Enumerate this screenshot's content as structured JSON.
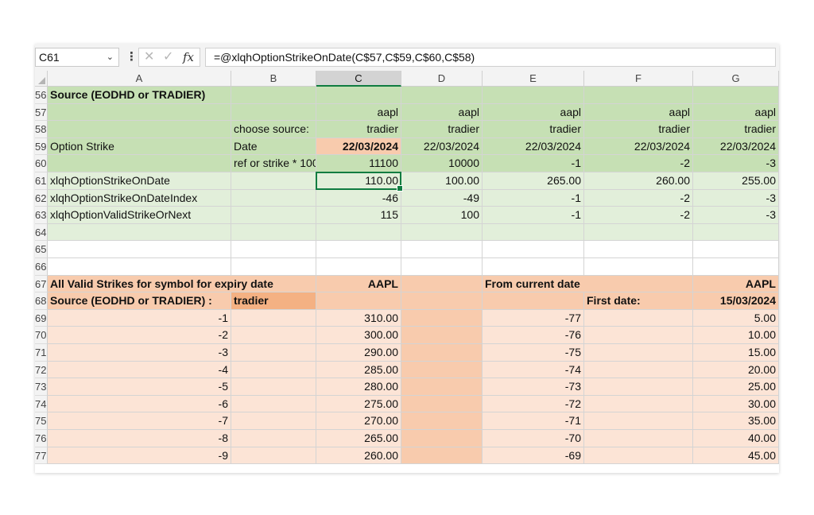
{
  "name_box": "C61",
  "formula": "=@xlqhOptionStrikeOnDate(C$57,C$59,C$60,C$58)",
  "icons": {
    "cancel": "x-icon",
    "confirm": "check-icon",
    "function": "fx-icon",
    "dropdown": "chevron-down-icon",
    "more": "vertical-dots-icon"
  },
  "colors": {
    "green_dark": "#c6e0b4",
    "green_light": "#e2efda",
    "peach_dark": "#f8cbad",
    "peach_light": "#fce4d6",
    "accent_orange": "#f4b183",
    "selection": "#107c41"
  },
  "columns": [
    "A",
    "B",
    "C",
    "D",
    "E",
    "F",
    "G"
  ],
  "selected_column": "C",
  "rows": [
    {
      "n": "56",
      "bg": "#c6e0b4",
      "cells": [
        {
          "c": "A",
          "v": "Source (EODHD or TRADIER)",
          "b": true
        }
      ]
    },
    {
      "n": "57",
      "bg": "#c6e0b4",
      "cells": [
        {
          "c": "C",
          "v": "aapl",
          "r": true
        },
        {
          "c": "D",
          "v": "aapl",
          "r": true
        },
        {
          "c": "E",
          "v": "aapl",
          "r": true
        },
        {
          "c": "F",
          "v": "aapl",
          "r": true
        },
        {
          "c": "G",
          "v": "aapl",
          "r": true
        }
      ]
    },
    {
      "n": "58",
      "bg": "#c6e0b4",
      "cells": [
        {
          "c": "B",
          "v": "choose source:"
        },
        {
          "c": "C",
          "v": "tradier",
          "r": true
        },
        {
          "c": "D",
          "v": "tradier",
          "r": true
        },
        {
          "c": "E",
          "v": "tradier",
          "r": true
        },
        {
          "c": "F",
          "v": "tradier",
          "r": true
        },
        {
          "c": "G",
          "v": "tradier",
          "r": true
        }
      ]
    },
    {
      "n": "59",
      "bg": "#c6e0b4",
      "cells": [
        {
          "c": "A",
          "v": "Option Strike"
        },
        {
          "c": "B",
          "v": "Date"
        },
        {
          "c": "C",
          "v": "22/03/2024",
          "r": true,
          "b": true,
          "bg": "#f8cbad"
        },
        {
          "c": "D",
          "v": "22/03/2024",
          "r": true
        },
        {
          "c": "E",
          "v": "22/03/2024",
          "r": true
        },
        {
          "c": "F",
          "v": "22/03/2024",
          "r": true
        },
        {
          "c": "G",
          "v": "22/03/2024",
          "r": true
        }
      ]
    },
    {
      "n": "60",
      "bg": "#c6e0b4",
      "cells": [
        {
          "c": "B",
          "v": "ref or strike * 1000"
        },
        {
          "c": "C",
          "v": "11100",
          "r": true
        },
        {
          "c": "D",
          "v": "10000",
          "r": true
        },
        {
          "c": "E",
          "v": "-1",
          "r": true
        },
        {
          "c": "F",
          "v": "-2",
          "r": true
        },
        {
          "c": "G",
          "v": "-3",
          "r": true
        }
      ]
    },
    {
      "n": "61",
      "bg": "#e2efda",
      "cells": [
        {
          "c": "A",
          "v": "xlqhOptionStrikeOnDate"
        },
        {
          "c": "C",
          "v": "110.00",
          "r": true
        },
        {
          "c": "D",
          "v": "100.00",
          "r": true
        },
        {
          "c": "E",
          "v": "265.00",
          "r": true
        },
        {
          "c": "F",
          "v": "260.00",
          "r": true
        },
        {
          "c": "G",
          "v": "255.00",
          "r": true
        }
      ]
    },
    {
      "n": "62",
      "bg": "#e2efda",
      "cells": [
        {
          "c": "A",
          "v": "xlqhOptionStrikeOnDateIndex"
        },
        {
          "c": "C",
          "v": "-46",
          "r": true
        },
        {
          "c": "D",
          "v": "-49",
          "r": true
        },
        {
          "c": "E",
          "v": "-1",
          "r": true
        },
        {
          "c": "F",
          "v": "-2",
          "r": true
        },
        {
          "c": "G",
          "v": "-3",
          "r": true
        }
      ]
    },
    {
      "n": "63",
      "bg": "#e2efda",
      "cells": [
        {
          "c": "A",
          "v": " xlqhOptionValidStrikeOrNext"
        },
        {
          "c": "C",
          "v": "115",
          "r": true
        },
        {
          "c": "D",
          "v": "100",
          "r": true
        },
        {
          "c": "E",
          "v": "-1",
          "r": true
        },
        {
          "c": "F",
          "v": "-2",
          "r": true
        },
        {
          "c": "G",
          "v": "-3",
          "r": true
        }
      ]
    },
    {
      "n": "64",
      "bg": "#e2efda",
      "cells": []
    },
    {
      "n": "65",
      "bg": "#ffffff",
      "cells": []
    },
    {
      "n": "66",
      "bg": "#ffffff",
      "cells": []
    },
    {
      "n": "67",
      "bg": "#f8cbad",
      "cells": [
        {
          "c": "A",
          "v": "All Valid Strikes for symbol for expiry date",
          "b": true
        },
        {
          "c": "C",
          "v": "AAPL",
          "r": true,
          "b": true
        },
        {
          "c": "E",
          "v": "From current date",
          "b": true
        },
        {
          "c": "G",
          "v": "AAPL",
          "r": true,
          "b": true
        }
      ]
    },
    {
      "n": "68",
      "bg": "#f8cbad",
      "cells": [
        {
          "c": "A",
          "v": "Source (EODHD or TRADIER) :",
          "b": true
        },
        {
          "c": "B",
          "v": "tradier",
          "b": true,
          "bg": "#f4b183"
        },
        {
          "c": "F",
          "v": "First date:",
          "b": true
        },
        {
          "c": "G",
          "v": "15/03/2024",
          "r": true,
          "b": true
        }
      ]
    },
    {
      "n": "69",
      "bg": "#fce4d6",
      "cells": [
        {
          "c": "A",
          "v": "-1",
          "r": true
        },
        {
          "c": "C",
          "v": "310.00",
          "r": true
        },
        {
          "c": "D",
          "v": "",
          "bg": "#f8cbad"
        },
        {
          "c": "E",
          "v": "-77",
          "r": true
        },
        {
          "c": "G",
          "v": "5.00",
          "r": true
        }
      ]
    },
    {
      "n": "70",
      "bg": "#fce4d6",
      "cells": [
        {
          "c": "A",
          "v": "-2",
          "r": true
        },
        {
          "c": "C",
          "v": "300.00",
          "r": true
        },
        {
          "c": "D",
          "v": "",
          "bg": "#f8cbad"
        },
        {
          "c": "E",
          "v": "-76",
          "r": true
        },
        {
          "c": "G",
          "v": "10.00",
          "r": true
        }
      ]
    },
    {
      "n": "71",
      "bg": "#fce4d6",
      "cells": [
        {
          "c": "A",
          "v": "-3",
          "r": true
        },
        {
          "c": "C",
          "v": "290.00",
          "r": true
        },
        {
          "c": "D",
          "v": "",
          "bg": "#f8cbad"
        },
        {
          "c": "E",
          "v": "-75",
          "r": true
        },
        {
          "c": "G",
          "v": "15.00",
          "r": true
        }
      ]
    },
    {
      "n": "72",
      "bg": "#fce4d6",
      "cells": [
        {
          "c": "A",
          "v": "-4",
          "r": true
        },
        {
          "c": "C",
          "v": "285.00",
          "r": true
        },
        {
          "c": "D",
          "v": "",
          "bg": "#f8cbad"
        },
        {
          "c": "E",
          "v": "-74",
          "r": true
        },
        {
          "c": "G",
          "v": "20.00",
          "r": true
        }
      ]
    },
    {
      "n": "73",
      "bg": "#fce4d6",
      "cells": [
        {
          "c": "A",
          "v": "-5",
          "r": true
        },
        {
          "c": "C",
          "v": "280.00",
          "r": true
        },
        {
          "c": "D",
          "v": "",
          "bg": "#f8cbad"
        },
        {
          "c": "E",
          "v": "-73",
          "r": true
        },
        {
          "c": "G",
          "v": "25.00",
          "r": true
        }
      ]
    },
    {
      "n": "74",
      "bg": "#fce4d6",
      "cells": [
        {
          "c": "A",
          "v": "-6",
          "r": true
        },
        {
          "c": "C",
          "v": "275.00",
          "r": true
        },
        {
          "c": "D",
          "v": "",
          "bg": "#f8cbad"
        },
        {
          "c": "E",
          "v": "-72",
          "r": true
        },
        {
          "c": "G",
          "v": "30.00",
          "r": true
        }
      ]
    },
    {
      "n": "75",
      "bg": "#fce4d6",
      "cells": [
        {
          "c": "A",
          "v": "-7",
          "r": true
        },
        {
          "c": "C",
          "v": "270.00",
          "r": true
        },
        {
          "c": "D",
          "v": "",
          "bg": "#f8cbad"
        },
        {
          "c": "E",
          "v": "-71",
          "r": true
        },
        {
          "c": "G",
          "v": "35.00",
          "r": true
        }
      ]
    },
    {
      "n": "76",
      "bg": "#fce4d6",
      "cells": [
        {
          "c": "A",
          "v": "-8",
          "r": true
        },
        {
          "c": "C",
          "v": "265.00",
          "r": true
        },
        {
          "c": "D",
          "v": "",
          "bg": "#f8cbad"
        },
        {
          "c": "E",
          "v": "-70",
          "r": true
        },
        {
          "c": "G",
          "v": "40.00",
          "r": true
        }
      ]
    },
    {
      "n": "77",
      "bg": "#fce4d6",
      "cells": [
        {
          "c": "A",
          "v": "-9",
          "r": true
        },
        {
          "c": "C",
          "v": "260.00",
          "r": true
        },
        {
          "c": "D",
          "v": "",
          "bg": "#f8cbad"
        },
        {
          "c": "E",
          "v": "-69",
          "r": true
        },
        {
          "c": "G",
          "v": "45.00",
          "r": true
        }
      ]
    }
  ]
}
